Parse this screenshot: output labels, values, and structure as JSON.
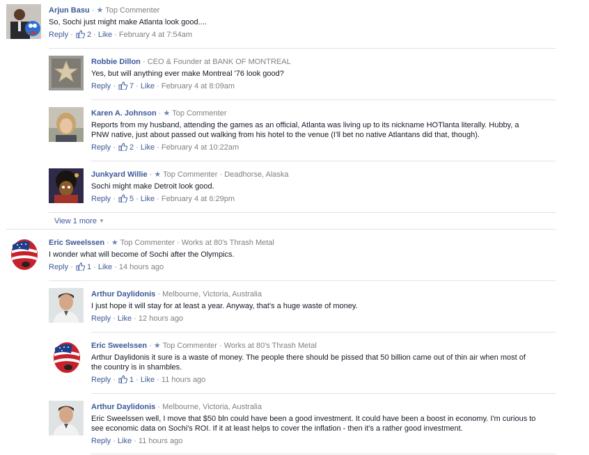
{
  "comments": [
    {
      "author": "Arjun Basu",
      "badge": "Top Commenter",
      "text": "So, Sochi just might make Atlanta look good....",
      "reply": "Reply",
      "likes": "2",
      "like": "Like",
      "time": "February 4 at 7:54am",
      "replies": [
        {
          "author": "Robbie Dillon",
          "detail": "CEO & Founder at BANK OF MONTREAL",
          "text": "Yes, but will anything ever make Montreal '76 look good?",
          "reply": "Reply",
          "likes": "7",
          "like": "Like",
          "time": "February 4 at 8:09am"
        },
        {
          "author": "Karen A. Johnson",
          "badge": "Top Commenter",
          "text": "Reports from my husband, attending the games as an official, Atlanta was living up to its nickname HOTlanta literally. Hubby, a PNW native, just about passed out walking from his hotel to the venue (I'll bet no native Atlantans did that, though).",
          "reply": "Reply",
          "likes": "2",
          "like": "Like",
          "time": "February 4 at 10:22am"
        },
        {
          "author": "Junkyard Willie",
          "badge": "Top Commenter",
          "detail": "Deadhorse, Alaska",
          "text": "Sochi might make Detroit look good.",
          "reply": "Reply",
          "likes": "5",
          "like": "Like",
          "time": "February 4 at 6:29pm"
        }
      ],
      "view_more": "View 1 more"
    },
    {
      "author": "Eric Sweelssen",
      "badge": "Top Commenter",
      "detail": "Works at 80's Thrash Metal",
      "text": "I wonder what will become of Sochi after the Olympics.",
      "reply": "Reply",
      "likes": "1",
      "like": "Like",
      "time": "14 hours ago",
      "replies": [
        {
          "author": "Arthur Daylidonis",
          "detail": "Melbourne, Victoria, Australia",
          "text": "I just hope it will stay for at least a year. Anyway, that's a huge waste of money.",
          "reply": "Reply",
          "like": "Like",
          "time": "12 hours ago"
        },
        {
          "author": "Eric Sweelssen",
          "badge": "Top Commenter",
          "detail": "Works at 80's Thrash Metal",
          "text": "Arthur Daylidonis it sure is a waste of money. The people there should be pissed that 50 billion came out of thin air when most of the country is in shambles.",
          "reply": "Reply",
          "likes": "1",
          "like": "Like",
          "time": "11 hours ago"
        },
        {
          "author": "Arthur Daylidonis",
          "detail": "Melbourne, Victoria, Australia",
          "text": "Eric Sweelssen well, I move that $50 bln could have been a good investment. It could have been a boost in economy. I'm curious to see economic data on Sochi's ROI. If it at least helps to cover the inflation - then it's a rather good investment.",
          "reply": "Reply",
          "like": "Like",
          "time": "11 hours ago"
        }
      ]
    }
  ],
  "icons": {
    "star": "star-icon",
    "like": "thumbs-up-icon",
    "caret": "caret-down-icon"
  },
  "colors": {
    "link": "#3b5998",
    "muted": "#7f7f7f",
    "separator": "#e1e2e3"
  }
}
